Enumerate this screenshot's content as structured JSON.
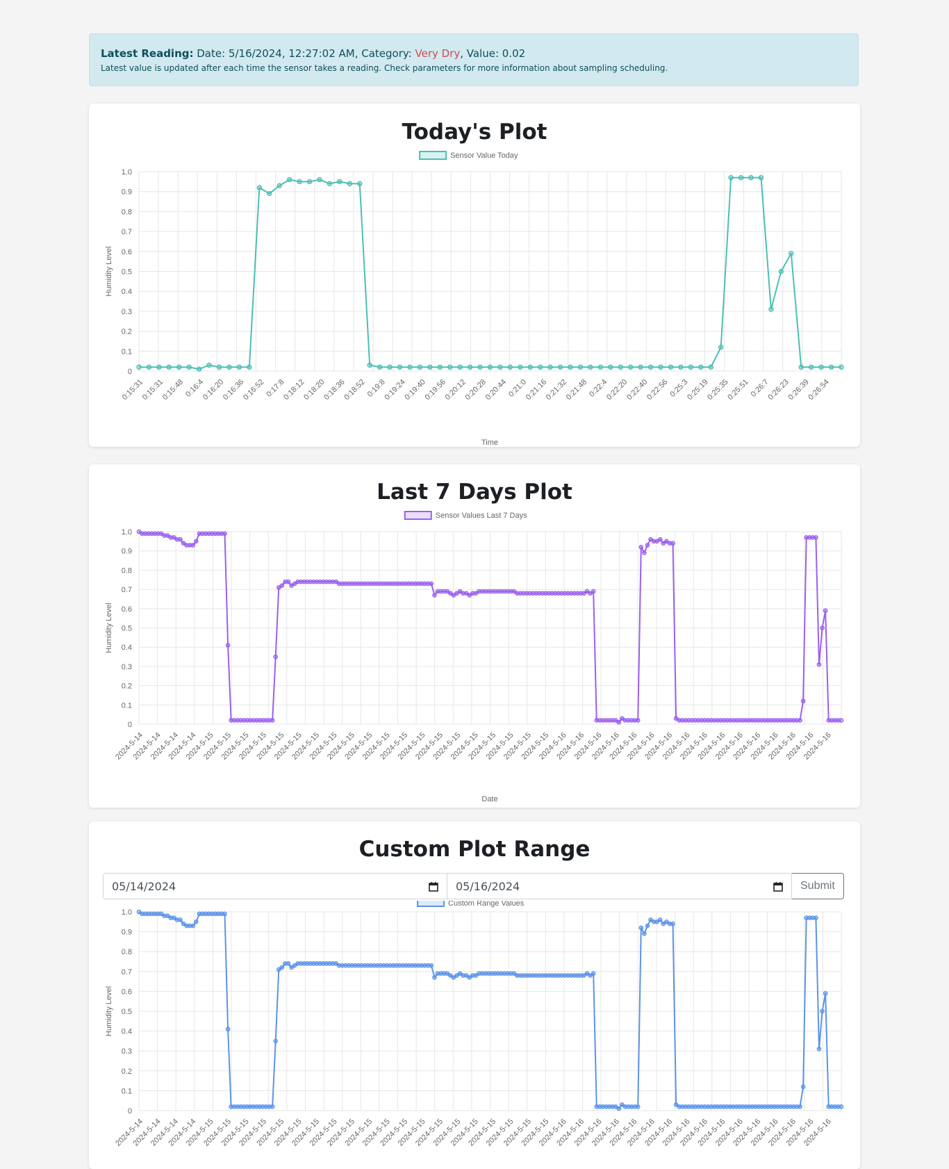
{
  "alert": {
    "label": "Latest Reading:",
    "date_prefix": " Date: 5/16/2024, 12:27:02 AM, Category: ",
    "category": "Very Dry",
    "value_text": ", Value: 0.02",
    "note": "Latest value is updated after each time the sensor takes a reading. Check parameters for more information about sampling scheduling."
  },
  "today": {
    "title": "Today's Plot"
  },
  "week": {
    "title": "Last 7 Days Plot"
  },
  "custom": {
    "title": "Custom Plot Range",
    "start_date": "05/14/2024",
    "end_date": "05/16/2024",
    "submit_label": "Submit"
  },
  "colors": {
    "today": "#4bbfb4",
    "week": "#9a5ff0",
    "custom": "#5b93e8",
    "very_dry": "#d14b55"
  },
  "chart_data": [
    {
      "type": "line",
      "legend": "Sensor Value Today",
      "xlabel": "Time",
      "ylabel": "Humidity Level",
      "ylim": [
        0,
        1
      ],
      "yticks": [
        "0",
        "0.1",
        "0.2",
        "0.3",
        "0.4",
        "0.5",
        "0.6",
        "0.7",
        "0.8",
        "0.9",
        "1.0"
      ],
      "xticklabels": [
        "0:15:31",
        "0:15:31",
        "0:15:48",
        "0:16:4",
        "0:16:20",
        "0:16:36",
        "0:16:52",
        "0:17:8",
        "0:18:12",
        "0:18:20",
        "0:18:36",
        "0:18:52",
        "0:19:8",
        "0:19:24",
        "0:19:40",
        "0:19:56",
        "0:20:12",
        "0:20:28",
        "0:20:44",
        "0:21:0",
        "0:21:16",
        "0:21:32",
        "0:21:48",
        "0:22:4",
        "0:22:20",
        "0:22:40",
        "0:22:56",
        "0:25:3",
        "0:25:19",
        "0:25:35",
        "0:25:51",
        "0:26:7",
        "0:26:23",
        "0:26:39",
        "0:26:54"
      ],
      "values": [
        0.02,
        0.02,
        0.02,
        0.02,
        0.02,
        0.02,
        0.01,
        0.03,
        0.02,
        0.02,
        0.02,
        0.02,
        0.92,
        0.89,
        0.93,
        0.96,
        0.95,
        0.95,
        0.96,
        0.94,
        0.95,
        0.94,
        0.94,
        0.03,
        0.02,
        0.02,
        0.02,
        0.02,
        0.02,
        0.02,
        0.02,
        0.02,
        0.02,
        0.02,
        0.02,
        0.02,
        0.02,
        0.02,
        0.02,
        0.02,
        0.02,
        0.02,
        0.02,
        0.02,
        0.02,
        0.02,
        0.02,
        0.02,
        0.02,
        0.02,
        0.02,
        0.02,
        0.02,
        0.02,
        0.02,
        0.02,
        0.02,
        0.02,
        0.12,
        0.97,
        0.97,
        0.97,
        0.97,
        0.31,
        0.5,
        0.59,
        0.02,
        0.02,
        0.02,
        0.02,
        0.02
      ],
      "grid": true
    },
    {
      "type": "line",
      "legend": "Sensor Values Last 7 Days",
      "xlabel": "Date",
      "ylabel": "Humidity Level",
      "ylim": [
        0,
        1
      ],
      "yticks": [
        "0",
        "0.1",
        "0.2",
        "0.3",
        "0.4",
        "0.5",
        "0.6",
        "0.7",
        "0.8",
        "0.9",
        "1.0"
      ],
      "xticklabels": [
        "2024-5-14",
        "2024-5-14",
        "2024-5-14",
        "2024-5-14",
        "2024-5-15",
        "2024-5-15",
        "2024-5-15",
        "2024-5-15",
        "2024-5-15",
        "2024-5-15",
        "2024-5-15",
        "2024-5-15",
        "2024-5-15",
        "2024-5-15",
        "2024-5-15",
        "2024-5-15",
        "2024-5-15",
        "2024-5-15",
        "2024-5-15",
        "2024-5-15",
        "2024-5-15",
        "2024-5-15",
        "2024-5-15",
        "2024-5-15",
        "2024-5-16",
        "2024-5-16",
        "2024-5-16",
        "2024-5-16",
        "2024-5-16",
        "2024-5-16",
        "2024-5-16",
        "2024-5-16",
        "2024-5-16",
        "2024-5-16",
        "2024-5-16",
        "2024-5-16",
        "2024-5-16",
        "2024-5-16",
        "2024-5-16",
        "2024-5-16"
      ],
      "values": [
        1.0,
        0.99,
        0.99,
        0.99,
        0.99,
        0.99,
        0.99,
        0.99,
        0.98,
        0.98,
        0.97,
        0.97,
        0.96,
        0.96,
        0.94,
        0.93,
        0.93,
        0.93,
        0.95,
        0.99,
        0.99,
        0.99,
        0.99,
        0.99,
        0.99,
        0.99,
        0.99,
        0.99,
        0.41,
        0.02,
        0.02,
        0.02,
        0.02,
        0.02,
        0.02,
        0.02,
        0.02,
        0.02,
        0.02,
        0.02,
        0.02,
        0.02,
        0.02,
        0.35,
        0.71,
        0.72,
        0.74,
        0.74,
        0.72,
        0.73,
        0.74,
        0.74,
        0.74,
        0.74,
        0.74,
        0.74,
        0.74,
        0.74,
        0.74,
        0.74,
        0.74,
        0.74,
        0.74,
        0.73,
        0.73,
        0.73,
        0.73,
        0.73,
        0.73,
        0.73,
        0.73,
        0.73,
        0.73,
        0.73,
        0.73,
        0.73,
        0.73,
        0.73,
        0.73,
        0.73,
        0.73,
        0.73,
        0.73,
        0.73,
        0.73,
        0.73,
        0.73,
        0.73,
        0.73,
        0.73,
        0.73,
        0.73,
        0.73,
        0.67,
        0.69,
        0.69,
        0.69,
        0.69,
        0.68,
        0.67,
        0.68,
        0.69,
        0.68,
        0.68,
        0.67,
        0.68,
        0.68,
        0.69,
        0.69,
        0.69,
        0.69,
        0.69,
        0.69,
        0.69,
        0.69,
        0.69,
        0.69,
        0.69,
        0.69,
        0.68,
        0.68,
        0.68,
        0.68,
        0.68,
        0.68,
        0.68,
        0.68,
        0.68,
        0.68,
        0.68,
        0.68,
        0.68,
        0.68,
        0.68,
        0.68,
        0.68,
        0.68,
        0.68,
        0.68,
        0.68,
        0.68,
        0.69,
        0.68,
        0.69,
        0.02,
        0.02,
        0.02,
        0.02,
        0.02,
        0.02,
        0.02,
        0.01,
        0.03,
        0.02,
        0.02,
        0.02,
        0.02,
        0.02,
        0.92,
        0.89,
        0.93,
        0.96,
        0.95,
        0.95,
        0.96,
        0.94,
        0.95,
        0.94,
        0.94,
        0.03,
        0.02,
        0.02,
        0.02,
        0.02,
        0.02,
        0.02,
        0.02,
        0.02,
        0.02,
        0.02,
        0.02,
        0.02,
        0.02,
        0.02,
        0.02,
        0.02,
        0.02,
        0.02,
        0.02,
        0.02,
        0.02,
        0.02,
        0.02,
        0.02,
        0.02,
        0.02,
        0.02,
        0.02,
        0.02,
        0.02,
        0.02,
        0.02,
        0.02,
        0.02,
        0.02,
        0.02,
        0.02,
        0.02,
        0.02,
        0.12,
        0.97,
        0.97,
        0.97,
        0.97,
        0.31,
        0.5,
        0.59,
        0.02,
        0.02,
        0.02,
        0.02,
        0.02
      ],
      "grid": true
    },
    {
      "type": "line",
      "legend": "Custom Range Values",
      "xlabel": "",
      "ylabel": "Humidity Level",
      "ylim": [
        0,
        1
      ],
      "yticks": [
        "0",
        "0.1",
        "0.2",
        "0.3",
        "0.4",
        "0.5",
        "0.6",
        "0.7",
        "0.8",
        "0.9",
        "1.0"
      ],
      "xticklabels": [
        "2024-5-14",
        "2024-5-14",
        "2024-5-14",
        "2024-5-14",
        "2024-5-15",
        "2024-5-15",
        "2024-5-15",
        "2024-5-15",
        "2024-5-15",
        "2024-5-15",
        "2024-5-15",
        "2024-5-15",
        "2024-5-15",
        "2024-5-15",
        "2024-5-15",
        "2024-5-15",
        "2024-5-15",
        "2024-5-15",
        "2024-5-15",
        "2024-5-15",
        "2024-5-15",
        "2024-5-15",
        "2024-5-15",
        "2024-5-15",
        "2024-5-16",
        "2024-5-16",
        "2024-5-16",
        "2024-5-16",
        "2024-5-16",
        "2024-5-16",
        "2024-5-16",
        "2024-5-16",
        "2024-5-16",
        "2024-5-16",
        "2024-5-16",
        "2024-5-16",
        "2024-5-16",
        "2024-5-16",
        "2024-5-16",
        "2024-5-16"
      ],
      "values": [
        1.0,
        0.99,
        0.99,
        0.99,
        0.99,
        0.99,
        0.99,
        0.99,
        0.98,
        0.98,
        0.97,
        0.97,
        0.96,
        0.96,
        0.94,
        0.93,
        0.93,
        0.93,
        0.95,
        0.99,
        0.99,
        0.99,
        0.99,
        0.99,
        0.99,
        0.99,
        0.99,
        0.99,
        0.41,
        0.02,
        0.02,
        0.02,
        0.02,
        0.02,
        0.02,
        0.02,
        0.02,
        0.02,
        0.02,
        0.02,
        0.02,
        0.02,
        0.02,
        0.35,
        0.71,
        0.72,
        0.74,
        0.74,
        0.72,
        0.73,
        0.74,
        0.74,
        0.74,
        0.74,
        0.74,
        0.74,
        0.74,
        0.74,
        0.74,
        0.74,
        0.74,
        0.74,
        0.74,
        0.73,
        0.73,
        0.73,
        0.73,
        0.73,
        0.73,
        0.73,
        0.73,
        0.73,
        0.73,
        0.73,
        0.73,
        0.73,
        0.73,
        0.73,
        0.73,
        0.73,
        0.73,
        0.73,
        0.73,
        0.73,
        0.73,
        0.73,
        0.73,
        0.73,
        0.73,
        0.73,
        0.73,
        0.73,
        0.73,
        0.67,
        0.69,
        0.69,
        0.69,
        0.69,
        0.68,
        0.67,
        0.68,
        0.69,
        0.68,
        0.68,
        0.67,
        0.68,
        0.68,
        0.69,
        0.69,
        0.69,
        0.69,
        0.69,
        0.69,
        0.69,
        0.69,
        0.69,
        0.69,
        0.69,
        0.69,
        0.68,
        0.68,
        0.68,
        0.68,
        0.68,
        0.68,
        0.68,
        0.68,
        0.68,
        0.68,
        0.68,
        0.68,
        0.68,
        0.68,
        0.68,
        0.68,
        0.68,
        0.68,
        0.68,
        0.68,
        0.68,
        0.68,
        0.69,
        0.68,
        0.69,
        0.02,
        0.02,
        0.02,
        0.02,
        0.02,
        0.02,
        0.02,
        0.01,
        0.03,
        0.02,
        0.02,
        0.02,
        0.02,
        0.02,
        0.92,
        0.89,
        0.93,
        0.96,
        0.95,
        0.95,
        0.96,
        0.94,
        0.95,
        0.94,
        0.94,
        0.03,
        0.02,
        0.02,
        0.02,
        0.02,
        0.02,
        0.02,
        0.02,
        0.02,
        0.02,
        0.02,
        0.02,
        0.02,
        0.02,
        0.02,
        0.02,
        0.02,
        0.02,
        0.02,
        0.02,
        0.02,
        0.02,
        0.02,
        0.02,
        0.02,
        0.02,
        0.02,
        0.02,
        0.02,
        0.02,
        0.02,
        0.02,
        0.02,
        0.02,
        0.02,
        0.02,
        0.02,
        0.02,
        0.02,
        0.02,
        0.12,
        0.97,
        0.97,
        0.97,
        0.97,
        0.31,
        0.5,
        0.59,
        0.02,
        0.02,
        0.02,
        0.02,
        0.02
      ],
      "grid": true
    }
  ]
}
